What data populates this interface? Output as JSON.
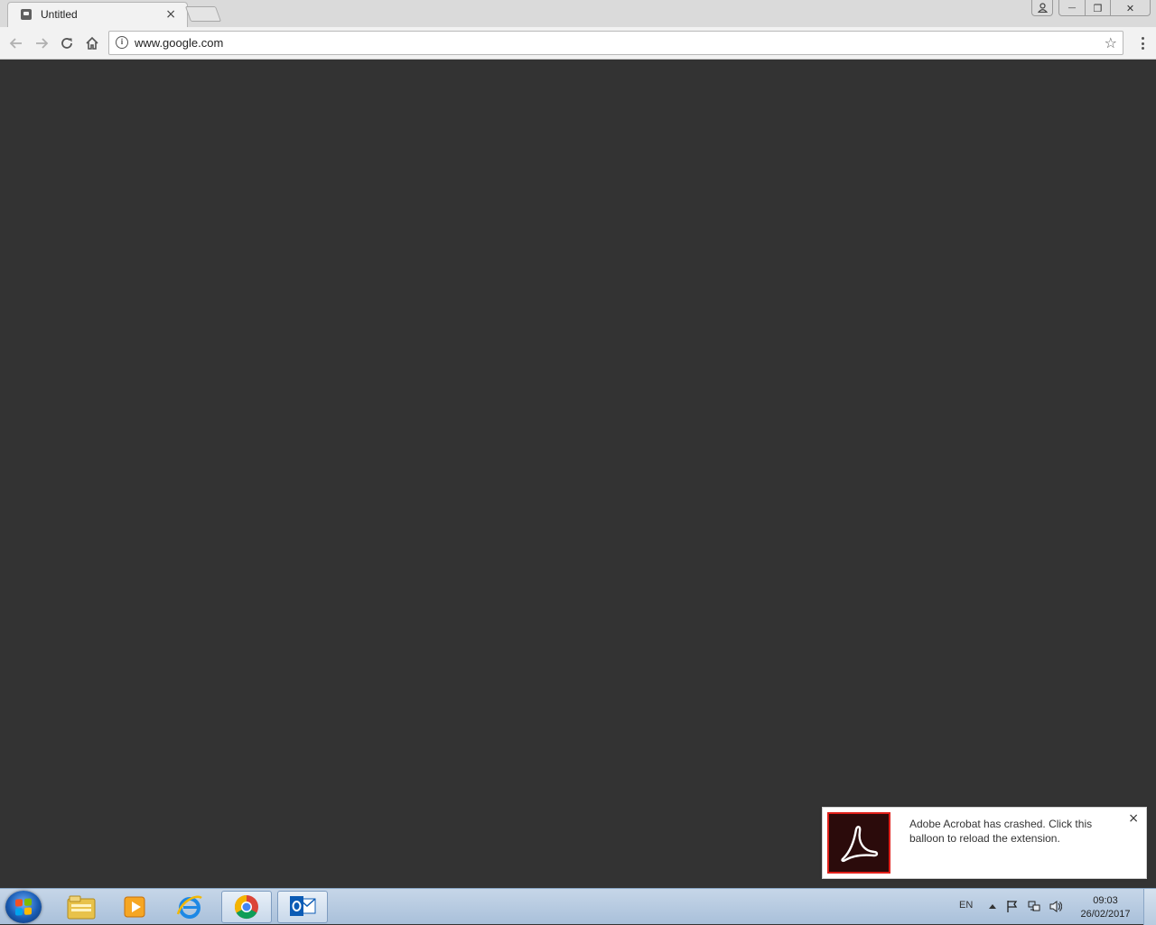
{
  "browser": {
    "tab": {
      "title": "Untitled",
      "close_glyph": "×"
    },
    "address_bar": {
      "url": "www.google.com",
      "info_glyph": "i",
      "star_glyph": "☆"
    },
    "window_controls": {
      "minimize": "—",
      "restore": "❐",
      "close": "✕"
    }
  },
  "notification": {
    "message": "Adobe Acrobat has crashed. Click this balloon to reload the extension.",
    "close_glyph": "×",
    "icon": "adobe-acrobat-icon"
  },
  "taskbar": {
    "pinned": [
      {
        "name": "windows-explorer-icon"
      },
      {
        "name": "media-player-icon"
      },
      {
        "name": "internet-explorer-icon"
      },
      {
        "name": "chrome-icon"
      },
      {
        "name": "outlook-icon"
      }
    ],
    "tray": {
      "language": "EN",
      "time": "09:03",
      "date": "26/02/2017"
    }
  },
  "colors": {
    "content_bg": "#333333",
    "acrobat_red": "#e0201a",
    "taskbar": "#b8cbe0"
  }
}
